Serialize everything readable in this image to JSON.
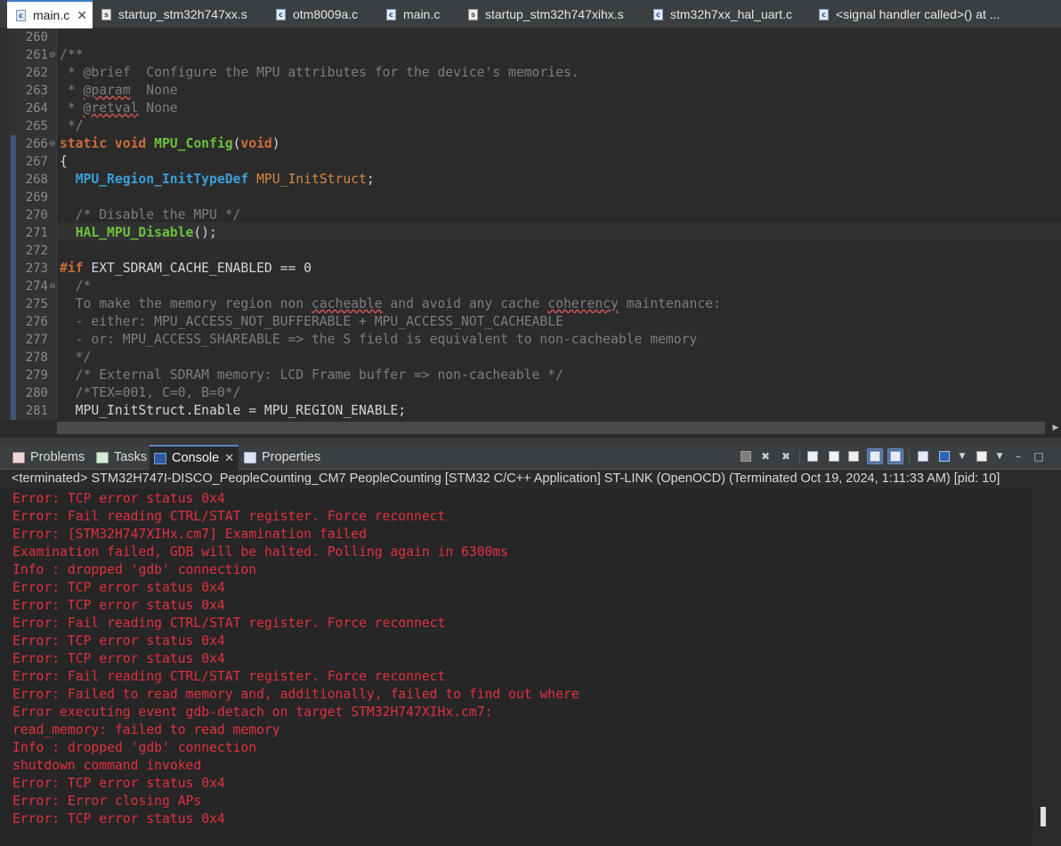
{
  "editor_tabs": [
    {
      "label": "main.c",
      "icon": "c-file-icon",
      "active": true,
      "closable": true
    },
    {
      "label": "startup_stm32h747xx.s",
      "icon": "asm-file-icon"
    },
    {
      "label": "otm8009a.c",
      "icon": "c-file-icon"
    },
    {
      "label": "main.c",
      "icon": "c-file-icon"
    },
    {
      "label": "startup_stm32h747xihx.s",
      "icon": "asm-file-icon"
    },
    {
      "label": "stm32h7xx_hal_uart.c",
      "icon": "c-file-icon"
    },
    {
      "label": "<signal handler called>() at ...",
      "icon": "c-file-icon"
    }
  ],
  "code": {
    "line_numbers": [
      "260",
      "261",
      "262",
      "263",
      "264",
      "265",
      "266",
      "267",
      "268",
      "269",
      "270",
      "271",
      "272",
      "273",
      "274",
      "275",
      "276",
      "277",
      "278",
      "279",
      "280",
      "281"
    ],
    "lines": [
      [],
      [
        {
          "t": "/**",
          "c": "cm"
        }
      ],
      [
        {
          "t": " * @brief  Configure the MPU attributes for the device's memories.",
          "c": "cm"
        }
      ],
      [
        {
          "t": " * ",
          "c": "cm"
        },
        {
          "t": "@param",
          "c": "cm sq"
        },
        {
          "t": "  None",
          "c": "cm"
        }
      ],
      [
        {
          "t": " * ",
          "c": "cm"
        },
        {
          "t": "@retval",
          "c": "cm sq"
        },
        {
          "t": " None",
          "c": "cm"
        }
      ],
      [
        {
          "t": " */",
          "c": "cm"
        }
      ],
      [
        {
          "t": "static",
          "c": "kw"
        },
        {
          "t": " "
        },
        {
          "t": "void",
          "c": "kw"
        },
        {
          "t": " "
        },
        {
          "t": "MPU_Config",
          "c": "fn"
        },
        {
          "t": "("
        },
        {
          "t": "void",
          "c": "kw"
        },
        {
          "t": ")"
        }
      ],
      [
        {
          "t": "{"
        }
      ],
      [
        {
          "t": "  "
        },
        {
          "t": "MPU_Region_InitTypeDef",
          "c": "ty"
        },
        {
          "t": " "
        },
        {
          "t": "MPU_InitStruct",
          "c": "var"
        },
        {
          "t": ";"
        }
      ],
      [],
      [
        {
          "t": "  /* Disable the MPU */",
          "c": "cm"
        }
      ],
      [
        {
          "t": "  "
        },
        {
          "t": "HAL_MPU_Disable",
          "c": "fn"
        },
        {
          "t": "();"
        }
      ],
      [],
      [
        {
          "t": "#if",
          "c": "pp"
        },
        {
          "t": " EXT_SDRAM_CACHE_ENABLED == 0"
        }
      ],
      [
        {
          "t": "  /*",
          "c": "cm"
        }
      ],
      [
        {
          "t": "  To make the memory region non ",
          "c": "cm"
        },
        {
          "t": "cacheable",
          "c": "cm sq"
        },
        {
          "t": " and avoid any cache ",
          "c": "cm"
        },
        {
          "t": "coherency",
          "c": "cm sq"
        },
        {
          "t": " maintenance:",
          "c": "cm"
        }
      ],
      [
        {
          "t": "  - either: MPU_ACCESS_NOT_BUFFERABLE + MPU_ACCESS_NOT_CACHEABLE",
          "c": "cm"
        }
      ],
      [
        {
          "t": "  - or: MPU_ACCESS_SHAREABLE => the S field is equivalent to non-cacheable memory",
          "c": "cm"
        }
      ],
      [
        {
          "t": "  */",
          "c": "cm"
        }
      ],
      [
        {
          "t": "  /* External SDRAM memory: LCD Frame buffer => non-cacheable */",
          "c": "cm"
        }
      ],
      [
        {
          "t": "  /*TEX=001, C=0, B=0*/",
          "c": "cm"
        }
      ],
      [
        {
          "t": "  MPU_InitStruct.Enable = MPU_REGION_ENABLE;"
        }
      ]
    ]
  },
  "panel_tabs": [
    {
      "label": "Problems",
      "icon": "problems-icon"
    },
    {
      "label": "Tasks",
      "icon": "tasks-icon"
    },
    {
      "label": "Console",
      "icon": "console-icon",
      "active": true,
      "closable": true
    },
    {
      "label": "Properties",
      "icon": "properties-icon"
    }
  ],
  "console": {
    "header": "<terminated> STM32H747I-DISCO_PeopleCounting_CM7 PeopleCounting [STM32 C/C++ Application] ST-LINK (OpenOCD) (Terminated Oct 19, 2024, 1:11:33 AM) [pid: 10]",
    "text_color": "#e0303f",
    "lines": [
      "Error: TCP error status 0x4",
      "Error: Fail reading CTRL/STAT register. Force reconnect",
      "Error: [STM32H747XIHx.cm7] Examination failed",
      "Examination failed, GDB will be halted. Polling again in 6300ms",
      "Info : dropped 'gdb' connection",
      "Error: TCP error status 0x4",
      "Error: TCP error status 0x4",
      "Error: Fail reading CTRL/STAT register. Force reconnect",
      "Error: TCP error status 0x4",
      "Error: TCP error status 0x4",
      "Error: Fail reading CTRL/STAT register. Force reconnect",
      "Error: Failed to read memory and, additionally, failed to find out where",
      "Error executing event gdb-detach on target STM32H747XIHx.cm7:",
      "read_memory: failed to read memory",
      "Info : dropped 'gdb' connection",
      "shutdown command invoked",
      "Error: TCP error status 0x4",
      "Error: Error closing APs",
      "Error: TCP error status 0x4"
    ]
  },
  "toolbar": {
    "minimize_glyph": "–",
    "maximize_glyph": "□"
  }
}
